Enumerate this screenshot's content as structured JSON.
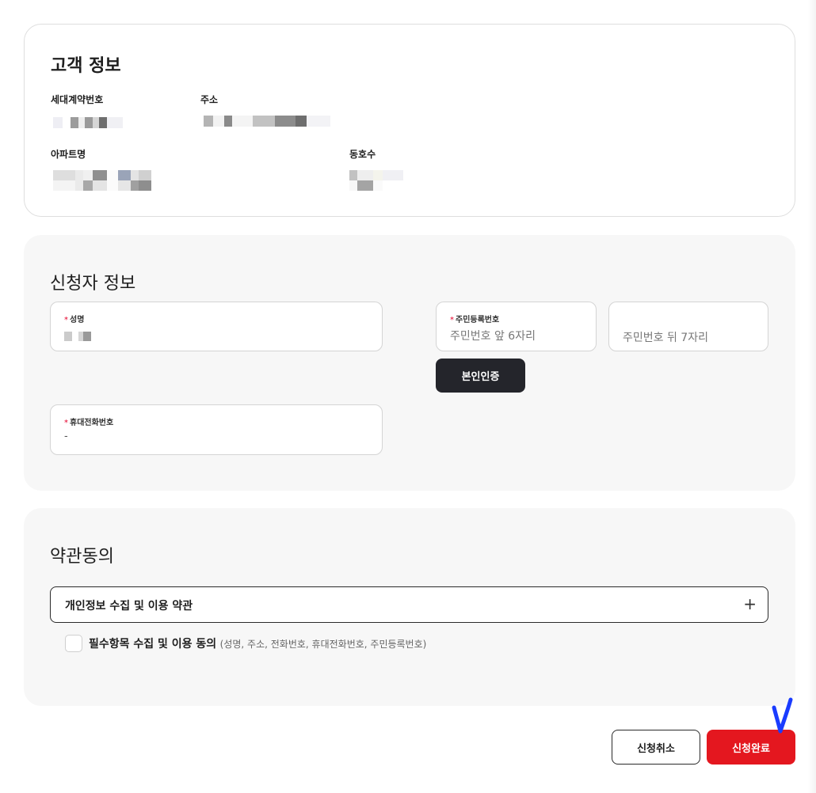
{
  "customer_info": {
    "title": "고객 정보",
    "household_contract_no_label": "세대계약번호",
    "address_label": "주소",
    "apartment_name_label": "아파트명",
    "unit_no_label": "동호수"
  },
  "applicant_info": {
    "title": "신청자 정보",
    "name_field": {
      "required_mark": "*",
      "label": "성명"
    },
    "rrn_field": {
      "required_mark": "*",
      "label": "주민등록번호",
      "front_placeholder": "주민번호 앞 6자리",
      "back_placeholder": "주민번호 뒤 7자리"
    },
    "verify_button": "본인인증",
    "mobile_field": {
      "required_mark": "*",
      "label": "휴대전화번호",
      "value": "-"
    }
  },
  "terms": {
    "title": "약관동의",
    "accordion_label": "개인정보 수집 및 이용 약관",
    "accordion_icon": "+",
    "checkbox_label": "필수항목 수집 및 이용 동의",
    "checkbox_detail": "(성명, 주소, 전화번호, 휴대전화번호, 주민등록번호)"
  },
  "actions": {
    "cancel_label": "신청취소",
    "submit_label": "신청완료"
  },
  "colors": {
    "primary_red": "#e4171f",
    "dark_button": "#24252b",
    "required_mark": "#e4002b",
    "annotation_blue": "#1a3cff"
  },
  "icons": {
    "accordion": "plus-icon",
    "annotation": "checkmark-annotation"
  }
}
